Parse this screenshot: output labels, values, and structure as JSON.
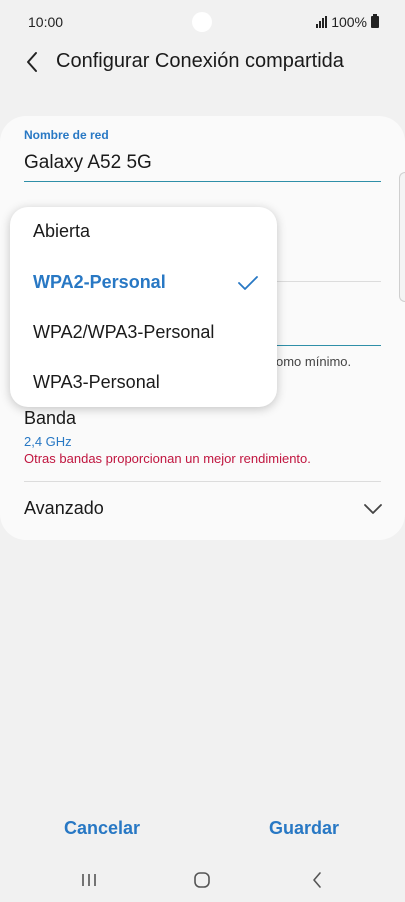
{
  "status_bar": {
    "time": "10:00",
    "battery": "100%"
  },
  "header": {
    "title": "Configurar Conexión compartida"
  },
  "network": {
    "label": "Nombre de red",
    "value": "Galaxy A52 5G"
  },
  "password_hint_partial": "omo mínimo.",
  "band": {
    "title": "Banda",
    "value": "2,4 GHz",
    "warning": "Otras bandas proporcionan un mejor rendimiento."
  },
  "advanced": {
    "label": "Avanzado"
  },
  "security_dropdown": {
    "options": [
      "Abierta",
      "WPA2-Personal",
      "WPA2/WPA3-Personal",
      "WPA3-Personal"
    ],
    "selected": "WPA2-Personal"
  },
  "actions": {
    "cancel": "Cancelar",
    "save": "Guardar"
  },
  "colors": {
    "accent": "#2878c4",
    "warning": "#c0153f",
    "background": "#f1f1f1"
  }
}
